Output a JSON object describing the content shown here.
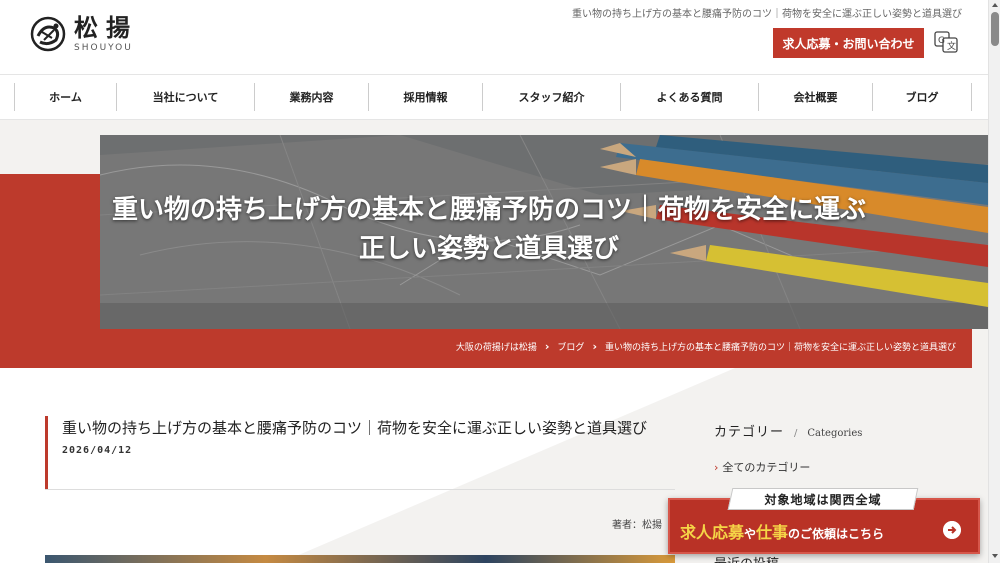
{
  "header": {
    "logo_name": "松揚",
    "logo_sub": "SHOUYOU",
    "top_title": "重い物の持ち上げ方の基本と腰痛予防のコツ｜荷物を安全に運ぶ正しい姿勢と道具選び",
    "cta_label": "求人応募・お問い合わせ",
    "translate_icon": "translate-icon"
  },
  "nav": {
    "items": [
      {
        "label": "ホーム"
      },
      {
        "label": "当社について"
      },
      {
        "label": "業務内容"
      },
      {
        "label": "採用情報"
      },
      {
        "label": "スタッフ紹介"
      },
      {
        "label": "よくある質問"
      },
      {
        "label": "会社概要"
      },
      {
        "label": "ブログ"
      }
    ]
  },
  "hero": {
    "title": "重い物の持ち上げ方の基本と腰痛予防のコツ｜荷物を安全に運ぶ正しい姿勢と道具選び",
    "breadcrumb": [
      "大阪の荷揚げは松揚",
      "ブログ",
      "重い物の持ち上げ方の基本と腰痛予防のコツ｜荷物を安全に運ぶ正しい姿勢と道具選び"
    ]
  },
  "article": {
    "title": "重い物の持ち上げ方の基本と腰痛予防のコツ｜荷物を安全に運ぶ正しい姿勢と道具選び",
    "date": "2026/04/12",
    "author_label": "著者：松揚"
  },
  "sidebar": {
    "heading_ja": "カテゴリー",
    "heading_sep": "/",
    "heading_en": "Categories",
    "all_categories": "全てのカテゴリー",
    "latest_label": "最近の投稿"
  },
  "banner": {
    "tab": "対象地域は関西全域",
    "part1": "求人応募",
    "part2": "や",
    "part3": "仕事",
    "part4": "のご依頼はこちら"
  },
  "colors": {
    "accent": "#bd3a2c",
    "banner_yellow": "#f5d547"
  }
}
